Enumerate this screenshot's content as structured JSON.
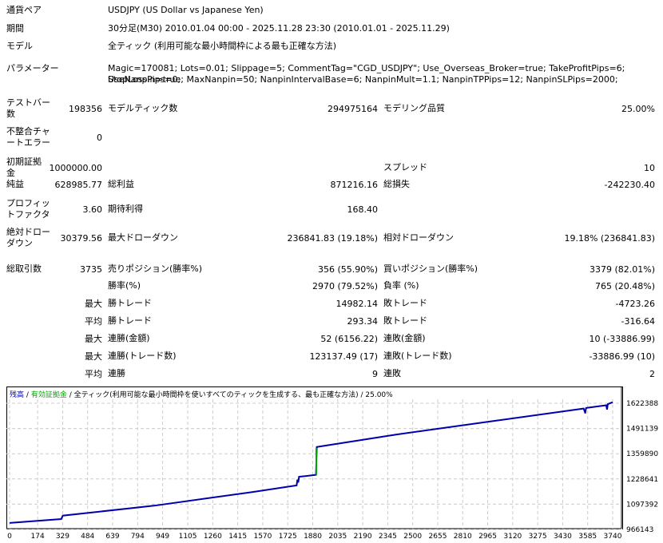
{
  "header": {
    "symbol_label": "通貨ペア",
    "symbol": "USDJPY (US Dollar vs Japanese Yen)",
    "period_label": "期間",
    "period": "30分足(M30) 2010.01.04 00:00 - 2025.11.28 23:30 (2010.01.01 - 2025.11.29)",
    "model_label": "モデル",
    "model": "全ティック (利用可能な最小時間枠による最も正確な方法)",
    "params_label": "パラメーター",
    "params_line1": "Magic=170081; Lots=0.01; Slippage=5; CommentTag=\"CGD_USDJPY\"; Use_Overseas_Broker=true; TakeProfitPips=6; StopLossPips=0;",
    "params_line2": "UseNanpin=true; MaxNanpin=50; NanpinIntervalBase=6; NanpinMult=1.1; NanpinTPPips=12; NanpinSLPips=2000;"
  },
  "stats": {
    "bars_label": "テストバー数",
    "bars": "198356",
    "ticks_label": "モデルティック数",
    "ticks": "294975164",
    "quality_label": "モデリング品質",
    "quality": "25.00%",
    "mismatch_label": "不整合チャートエラー",
    "mismatch": "0",
    "deposit_label": "初期証拠金",
    "deposit": "1000000.00",
    "spread_label": "スプレッド",
    "spread": "10",
    "net_label": "純益",
    "net": "628985.77",
    "gross_profit_label": "総利益",
    "gross_profit": "871216.16",
    "gross_loss_label": "総損失",
    "gross_loss": "-242230.40",
    "pf_label": "プロフィットファクタ",
    "pf": "3.60",
    "expected_label": "期待利得",
    "expected": "168.40",
    "abs_dd_label": "絶対ドローダウン",
    "abs_dd": "30379.56",
    "max_dd_label": "最大ドローダウン",
    "max_dd": "236841.83 (19.18%)",
    "rel_dd_label": "相対ドローダウン",
    "rel_dd": "19.18% (236841.83)",
    "trades_label": "総取引数",
    "trades": "3735",
    "short_label": "売りポジション(勝率%)",
    "short": "356 (55.90%)",
    "long_label": "買いポジション(勝率%)",
    "long": "3379 (82.01%)",
    "win_label": "勝率(%)",
    "win": "2970 (79.52%)",
    "loss_label": "負率 (%)",
    "loss": "765 (20.48%)",
    "max1": "最大",
    "lwin_label": "勝トレード",
    "lwin": "14982.14",
    "lloss_label": "敗トレード",
    "lloss": "-4723.26",
    "avg1": "平均",
    "awin_label": "勝トレード",
    "awin": "293.34",
    "aloss_label": "敗トレード",
    "aloss": "-316.64",
    "max2": "最大",
    "cwin_label": "連勝(金額)",
    "cwin": "52 (6156.22)",
    "closs_label": "連敗(金額)",
    "closs": "10 (-33886.99)",
    "max3": "最大",
    "cpwin_label": "連勝(トレード数)",
    "cpwin": "123137.49 (17)",
    "cploss_label": "連敗(トレード数)",
    "cploss": "-33886.99 (10)",
    "avg2": "平均",
    "acwin_label": "連勝",
    "acwin": "9",
    "acloss_label": "連敗",
    "acloss": "2"
  },
  "chart_data": {
    "type": "line",
    "legend": {
      "balance": "残高",
      "equity": "有効証拠金",
      "model": "全ティック(利用可能な最小時間枠を使いすべてのティックを生成する、最も正確な方法)",
      "quality": "25.00%",
      "sep": "/"
    },
    "colors": {
      "balance": "#0000aa",
      "equity": "#00aa00"
    },
    "x_ticks": [
      "0",
      "174",
      "329",
      "484",
      "639",
      "794",
      "949",
      "1105",
      "1260",
      "1415",
      "1570",
      "1725",
      "1880",
      "2035",
      "2190",
      "2345",
      "2500",
      "2655",
      "2810",
      "2965",
      "3120",
      "3275",
      "3430",
      "3585",
      "3740"
    ],
    "y_ticks": [
      "1622388",
      "1491139",
      "1359890",
      "1228641",
      "1097392",
      "966143"
    ],
    "xlim": [
      0,
      3740
    ],
    "ylim": [
      966143,
      1622388
    ],
    "series": [
      {
        "name": "残高",
        "x": [
          0,
          320,
          330,
          900,
          1500,
          1780,
          1785,
          1790,
          1795,
          1880,
          1900,
          1905,
          2400,
          3000,
          3560,
          3570,
          3575,
          3700,
          3705,
          3710,
          3740
        ],
        "y": [
          1000000,
          1020000,
          1038000,
          1090000,
          1160000,
          1195000,
          1225000,
          1210000,
          1240000,
          1248000,
          1250000,
          1395000,
          1460000,
          1530000,
          1595000,
          1570000,
          1598000,
          1612000,
          1590000,
          1618000,
          1628000
        ]
      }
    ]
  }
}
